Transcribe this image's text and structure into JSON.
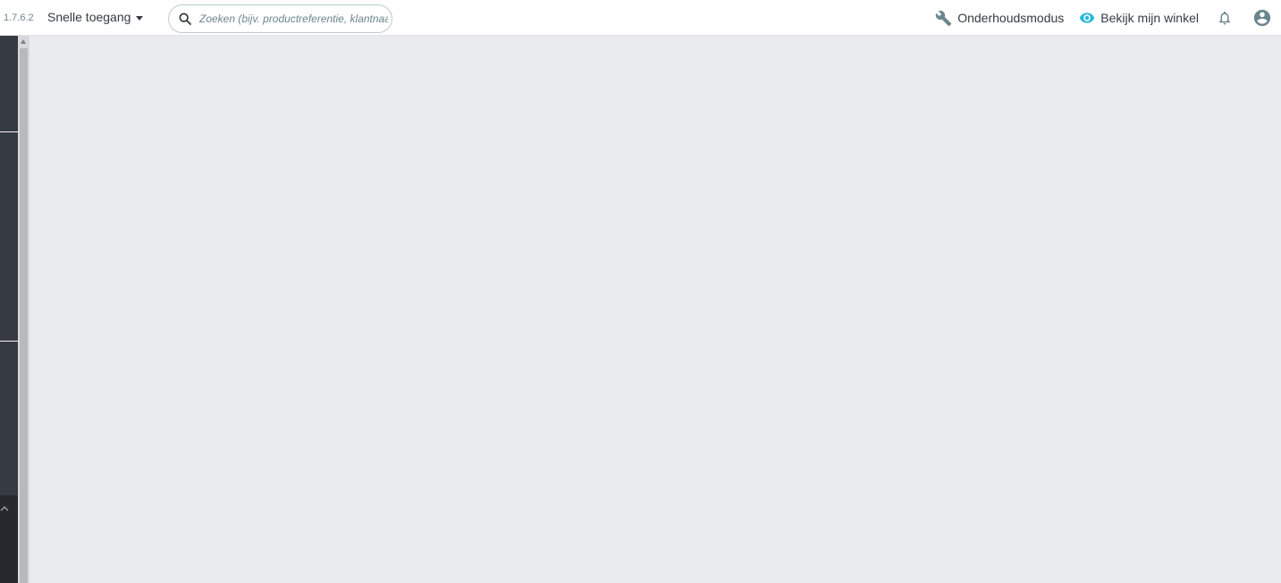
{
  "header": {
    "version": "1.7.6.2",
    "quick_access_label": "Snelle toegang",
    "search_placeholder": "Zoeken (bijv. productreferentie, klantnaam",
    "maintenance_label": "Onderhoudsmodus",
    "view_shop_label": "Bekijk mijn winkel"
  },
  "icons": {
    "search": "search-icon",
    "maintenance": "wrench-icon",
    "view_shop": "eye-icon",
    "notifications": "bell-icon",
    "account": "user-icon",
    "sidebar_toggle": "chevron-up-icon"
  },
  "colors": {
    "accent": "#25b9d7",
    "text": "#363a41",
    "muted": "#6c868e",
    "sidebar": "#363a41",
    "page_background": "#eaebec"
  }
}
